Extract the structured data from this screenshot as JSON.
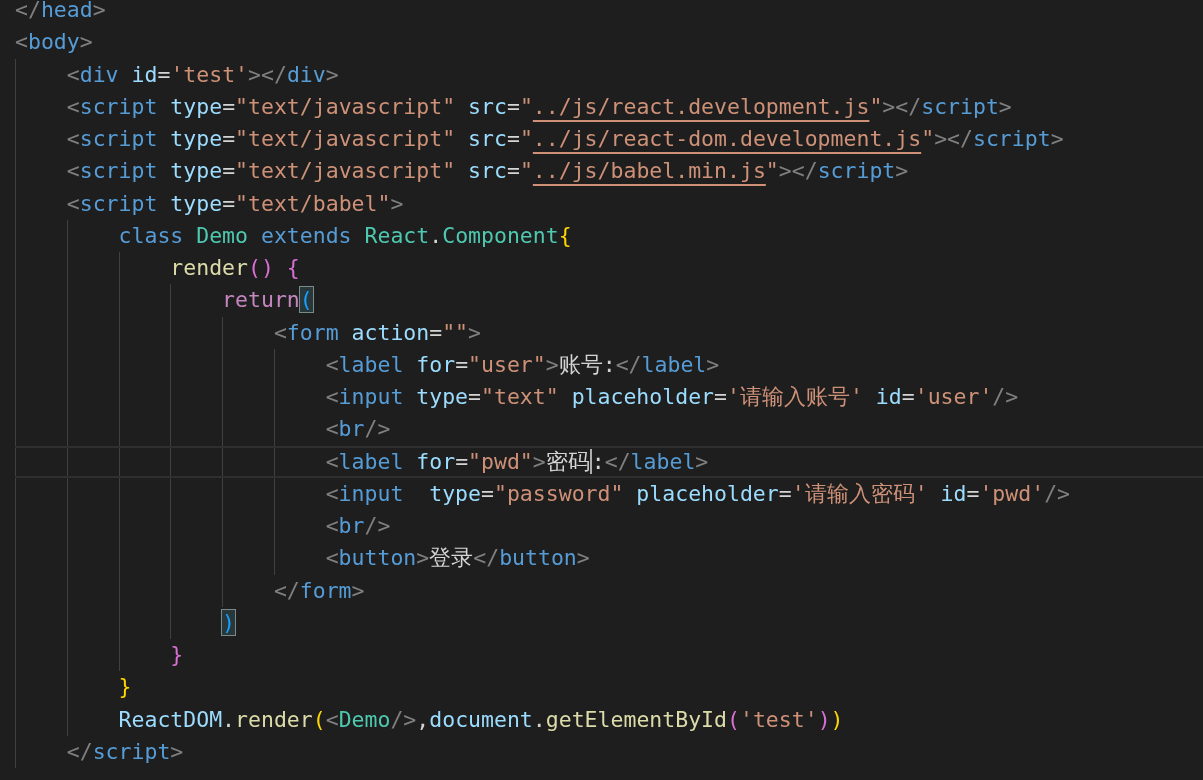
{
  "editor": {
    "lines": [
      {
        "tokens": [
          {
            "text": "</",
            "kind": "punct"
          },
          {
            "text": "head",
            "kind": "tag"
          },
          {
            "text": ">",
            "kind": "punct"
          }
        ]
      },
      {
        "tokens": [
          {
            "text": "<",
            "kind": "punct"
          },
          {
            "text": "body",
            "kind": "tag"
          },
          {
            "text": ">",
            "kind": "punct"
          }
        ]
      },
      {
        "tokens": [
          {
            "text": "    <",
            "kind": "punct"
          },
          {
            "text": "div",
            "kind": "tag"
          },
          {
            "text": " id",
            "kind": "attr"
          },
          {
            "text": "=",
            "kind": "plain"
          },
          {
            "text": "'test'",
            "kind": "str"
          },
          {
            "text": "></",
            "kind": "punct"
          },
          {
            "text": "div",
            "kind": "tag"
          },
          {
            "text": ">",
            "kind": "punct"
          }
        ]
      },
      {
        "tokens": [
          {
            "text": "    <",
            "kind": "punct"
          },
          {
            "text": "script",
            "kind": "tag"
          },
          {
            "text": " type",
            "kind": "attr"
          },
          {
            "text": "=",
            "kind": "plain"
          },
          {
            "text": "\"text/javascript\"",
            "kind": "str"
          },
          {
            "text": " src",
            "kind": "attr"
          },
          {
            "text": "=",
            "kind": "plain"
          },
          {
            "text": "\"",
            "kind": "str"
          },
          {
            "text": "../js/react.development.js",
            "kind": "link"
          },
          {
            "text": "\"",
            "kind": "str"
          },
          {
            "text": "></",
            "kind": "punct"
          },
          {
            "text": "script",
            "kind": "tag"
          },
          {
            "text": ">",
            "kind": "punct"
          }
        ]
      },
      {
        "tokens": [
          {
            "text": "    <",
            "kind": "punct"
          },
          {
            "text": "script",
            "kind": "tag"
          },
          {
            "text": " type",
            "kind": "attr"
          },
          {
            "text": "=",
            "kind": "plain"
          },
          {
            "text": "\"text/javascript\"",
            "kind": "str"
          },
          {
            "text": " src",
            "kind": "attr"
          },
          {
            "text": "=",
            "kind": "plain"
          },
          {
            "text": "\"",
            "kind": "str"
          },
          {
            "text": "../js/react-dom.development.js",
            "kind": "link"
          },
          {
            "text": "\"",
            "kind": "str"
          },
          {
            "text": "></",
            "kind": "punct"
          },
          {
            "text": "script",
            "kind": "tag"
          },
          {
            "text": ">",
            "kind": "punct"
          }
        ]
      },
      {
        "tokens": [
          {
            "text": "    <",
            "kind": "punct"
          },
          {
            "text": "script",
            "kind": "tag"
          },
          {
            "text": " type",
            "kind": "attr"
          },
          {
            "text": "=",
            "kind": "plain"
          },
          {
            "text": "\"text/javascript\"",
            "kind": "str"
          },
          {
            "text": " src",
            "kind": "attr"
          },
          {
            "text": "=",
            "kind": "plain"
          },
          {
            "text": "\"",
            "kind": "str"
          },
          {
            "text": "../js/babel.min.js",
            "kind": "link"
          },
          {
            "text": "\"",
            "kind": "str"
          },
          {
            "text": "></",
            "kind": "punct"
          },
          {
            "text": "script",
            "kind": "tag"
          },
          {
            "text": ">",
            "kind": "punct"
          }
        ]
      },
      {
        "tokens": [
          {
            "text": "    <",
            "kind": "punct"
          },
          {
            "text": "script",
            "kind": "tag"
          },
          {
            "text": " type",
            "kind": "attr"
          },
          {
            "text": "=",
            "kind": "plain"
          },
          {
            "text": "\"text/babel\"",
            "kind": "str"
          },
          {
            "text": ">",
            "kind": "punct"
          }
        ]
      },
      {
        "tokens": [
          {
            "text": "        class",
            "kind": "kw"
          },
          {
            "text": " Demo",
            "kind": "type"
          },
          {
            "text": " extends",
            "kind": "kw"
          },
          {
            "text": " React",
            "kind": "type"
          },
          {
            "text": ".",
            "kind": "plain"
          },
          {
            "text": "Component",
            "kind": "type"
          },
          {
            "text": "{",
            "kind": "br1"
          }
        ]
      },
      {
        "tokens": [
          {
            "text": "            render",
            "kind": "fn"
          },
          {
            "text": "()",
            "kind": "br2"
          },
          {
            "text": " {",
            "kind": "br2"
          }
        ]
      },
      {
        "tokens": [
          {
            "text": "                return",
            "kind": "ctrl"
          },
          {
            "text": "(",
            "kind": "br3",
            "matched": true
          }
        ]
      },
      {
        "tokens": [
          {
            "text": "                    <",
            "kind": "punct"
          },
          {
            "text": "form",
            "kind": "tag"
          },
          {
            "text": " action",
            "kind": "attr"
          },
          {
            "text": "=",
            "kind": "plain"
          },
          {
            "text": "\"\"",
            "kind": "str"
          },
          {
            "text": ">",
            "kind": "punct"
          }
        ]
      },
      {
        "tokens": [
          {
            "text": "                        <",
            "kind": "punct"
          },
          {
            "text": "label",
            "kind": "tag"
          },
          {
            "text": " for",
            "kind": "attr"
          },
          {
            "text": "=",
            "kind": "plain"
          },
          {
            "text": "\"user\"",
            "kind": "str"
          },
          {
            "text": ">",
            "kind": "punct"
          },
          {
            "text": "账号:",
            "kind": "plain"
          },
          {
            "text": "</",
            "kind": "punct"
          },
          {
            "text": "label",
            "kind": "tag"
          },
          {
            "text": ">",
            "kind": "punct"
          }
        ]
      },
      {
        "tokens": [
          {
            "text": "                        <",
            "kind": "punct"
          },
          {
            "text": "input",
            "kind": "tag"
          },
          {
            "text": " type",
            "kind": "attr"
          },
          {
            "text": "=",
            "kind": "plain"
          },
          {
            "text": "\"text\"",
            "kind": "str"
          },
          {
            "text": " placeholder",
            "kind": "attr"
          },
          {
            "text": "=",
            "kind": "plain"
          },
          {
            "text": "'请输入账号'",
            "kind": "str"
          },
          {
            "text": " id",
            "kind": "attr"
          },
          {
            "text": "=",
            "kind": "plain"
          },
          {
            "text": "'user'",
            "kind": "str"
          },
          {
            "text": "/>",
            "kind": "punct"
          }
        ]
      },
      {
        "tokens": [
          {
            "text": "                        <",
            "kind": "punct"
          },
          {
            "text": "br",
            "kind": "tag"
          },
          {
            "text": "/>",
            "kind": "punct"
          }
        ]
      },
      {
        "current": true,
        "tokens": [
          {
            "text": "                        <",
            "kind": "punct"
          },
          {
            "text": "label",
            "kind": "tag"
          },
          {
            "text": " for",
            "kind": "attr"
          },
          {
            "text": "=",
            "kind": "plain"
          },
          {
            "text": "\"pwd\"",
            "kind": "str"
          },
          {
            "text": ">",
            "kind": "punct"
          },
          {
            "text": "密码",
            "kind": "plain"
          },
          {
            "text": ":",
            "kind": "plain",
            "caret": true
          },
          {
            "text": "</",
            "kind": "punct"
          },
          {
            "text": "label",
            "kind": "tag"
          },
          {
            "text": ">",
            "kind": "punct"
          }
        ]
      },
      {
        "tokens": [
          {
            "text": "                        <",
            "kind": "punct"
          },
          {
            "text": "input",
            "kind": "tag"
          },
          {
            "text": "  type",
            "kind": "attr"
          },
          {
            "text": "=",
            "kind": "plain"
          },
          {
            "text": "\"password\"",
            "kind": "str"
          },
          {
            "text": " placeholder",
            "kind": "attr"
          },
          {
            "text": "=",
            "kind": "plain"
          },
          {
            "text": "'请输入密码'",
            "kind": "str"
          },
          {
            "text": " id",
            "kind": "attr"
          },
          {
            "text": "=",
            "kind": "plain"
          },
          {
            "text": "'pwd'",
            "kind": "str"
          },
          {
            "text": "/>",
            "kind": "punct"
          }
        ]
      },
      {
        "tokens": [
          {
            "text": "                        <",
            "kind": "punct"
          },
          {
            "text": "br",
            "kind": "tag"
          },
          {
            "text": "/>",
            "kind": "punct"
          }
        ]
      },
      {
        "tokens": [
          {
            "text": "                        <",
            "kind": "punct"
          },
          {
            "text": "button",
            "kind": "tag"
          },
          {
            "text": ">",
            "kind": "punct"
          },
          {
            "text": "登录",
            "kind": "plain"
          },
          {
            "text": "</",
            "kind": "punct"
          },
          {
            "text": "button",
            "kind": "tag"
          },
          {
            "text": ">",
            "kind": "punct"
          }
        ]
      },
      {
        "tokens": [
          {
            "text": "                    </",
            "kind": "punct"
          },
          {
            "text": "form",
            "kind": "tag"
          },
          {
            "text": ">",
            "kind": "punct"
          }
        ]
      },
      {
        "tokens": [
          {
            "text": "                )",
            "kind": "br3",
            "matched": true
          }
        ]
      },
      {
        "tokens": [
          {
            "text": "            }",
            "kind": "br2"
          }
        ]
      },
      {
        "tokens": [
          {
            "text": "        }",
            "kind": "br1"
          }
        ]
      },
      {
        "tokens": [
          {
            "text": "        ReactDOM",
            "kind": "var"
          },
          {
            "text": ".",
            "kind": "plain"
          },
          {
            "text": "render",
            "kind": "fn"
          },
          {
            "text": "(",
            "kind": "br1"
          },
          {
            "text": "<",
            "kind": "punct"
          },
          {
            "text": "Demo",
            "kind": "type"
          },
          {
            "text": "/>",
            "kind": "punct"
          },
          {
            "text": ",",
            "kind": "plain"
          },
          {
            "text": "document",
            "kind": "var"
          },
          {
            "text": ".",
            "kind": "plain"
          },
          {
            "text": "getElementById",
            "kind": "fn"
          },
          {
            "text": "(",
            "kind": "br2"
          },
          {
            "text": "'test'",
            "kind": "str"
          },
          {
            "text": ")",
            "kind": "br2"
          },
          {
            "text": ")",
            "kind": "br1"
          }
        ]
      },
      {
        "tokens": [
          {
            "text": "    </",
            "kind": "punct"
          },
          {
            "text": "script",
            "kind": "tag"
          },
          {
            "text": ">",
            "kind": "punct"
          }
        ]
      }
    ]
  }
}
